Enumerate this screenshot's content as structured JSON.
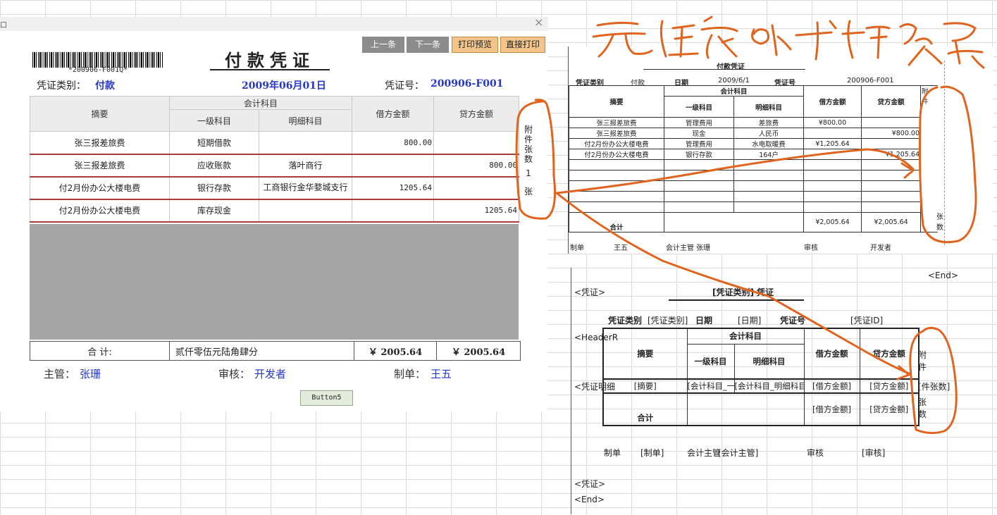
{
  "dialog": {
    "title": "口",
    "close_icon": "close-icon",
    "barcode_text": "*200906-F001Q*",
    "voucher_title": "付款凭证",
    "buttons": {
      "prev": "上一条",
      "next": "下一条",
      "preview": "打印预览",
      "print": "直接打印"
    },
    "type_label": "凭证类别：",
    "type_value": "付款",
    "date_value": "2009年06月01日",
    "number_label": "凭证号：",
    "number_value": "200906-F001",
    "table": {
      "headers": {
        "summary": "摘要",
        "account_group": "会计科目",
        "level1": "一级科目",
        "detail": "明细科目",
        "debit": "借方金额",
        "credit": "贷方金额"
      },
      "rows": [
        {
          "summary": "张三报差旅费",
          "level1": "短期借款",
          "detail": "",
          "debit": "800.00",
          "credit": ""
        },
        {
          "summary": "张三报差旅费",
          "level1": "应收账款",
          "detail": "落叶商行",
          "debit": "",
          "credit": "800.00"
        },
        {
          "summary": "付2月份办公大楼电费",
          "level1": "银行存款",
          "detail": "工商银行金华婺城支行",
          "debit": "1205.64",
          "credit": ""
        },
        {
          "summary": "付2月份办公大楼电费",
          "level1": "库存现金",
          "detail": "",
          "debit": "",
          "credit": "1205.64"
        }
      ]
    },
    "attachment": {
      "label": "附件张数",
      "count": "1",
      "unit": "张"
    },
    "total": {
      "label": "合  计:",
      "amount_words": "贰仟零伍元陆角肆分",
      "debit": "￥ 2005.64",
      "credit": "￥ 2005.64"
    },
    "signatures": {
      "supervisor_label": "主管：",
      "supervisor": "张珊",
      "auditor_label": "审核：",
      "auditor": "开发者",
      "maker_label": "制单：",
      "maker": "王五"
    },
    "button5": "Button5"
  },
  "preview": {
    "title": "付款凭证",
    "type_label": "凭证类别",
    "type_value": "付款",
    "date_label": "日期",
    "date_value": "2009/6/1",
    "number_label": "凭证号",
    "number_value": "200906-F001",
    "headers": {
      "summary": "摘要",
      "account_group": "会计科目",
      "level1": "一级科目",
      "detail": "明细科目",
      "debit": "借方金额",
      "credit": "贷方金额",
      "attach": "附件"
    },
    "rows": [
      {
        "summary": "张三报差旅费",
        "level1": "管理费用",
        "detail": "差旅费",
        "debit": "¥800.00",
        "credit": ""
      },
      {
        "summary": "张三报差旅费",
        "level1": "现金",
        "detail": "人民币",
        "debit": "",
        "credit": "¥800.00"
      },
      {
        "summary": "付2月份办公大楼电费",
        "level1": "管理费用",
        "detail": "水电取暖费",
        "debit": "¥1,205.64",
        "credit": ""
      },
      {
        "summary": "付2月份办公大楼电费",
        "level1": "银行存款",
        "detail": "164户",
        "debit": "",
        "credit": "¥1,205.64"
      }
    ],
    "total_label": "合计",
    "total_debit": "¥2,005.64",
    "total_credit": "¥2,005.64",
    "total_unit": "张数",
    "footer": {
      "maker_label": "制单",
      "maker": "王五",
      "supervisor": "会计主管 张珊",
      "auditor_label": "审核",
      "developer": "开发者"
    }
  },
  "template": {
    "end_top": "<End>",
    "voucher_tag": "<凭证>",
    "title": "[凭证类别]  凭证",
    "type_label": "凭证类别",
    "type_value": "[凭证类别]",
    "date_label": "日期",
    "date_value": "[日期]",
    "number_label": "凭证号",
    "number_value": "[凭证ID]",
    "header_tag": "<HeaderR",
    "detail_tag": "<凭证明细",
    "headers": {
      "summary": "摘要",
      "account_group": "会计科目",
      "level1": "一级科目",
      "detail": "明细科目",
      "debit": "借方金额",
      "credit": "贷方金额",
      "attach": "附件"
    },
    "row": {
      "summary": "[摘要]",
      "level1": "[会计科目_一级科目]",
      "detail": "[会计科目_明细科目]",
      "debit": "[借方金额]",
      "credit": "[贷方金额]",
      "attach": "[件张数]"
    },
    "total": {
      "label": "合计",
      "debit": "[借方金额]",
      "credit": "[贷方金额]",
      "unit": "张数"
    },
    "footer": {
      "maker_label": "制单",
      "maker": "[制单]",
      "supervisor_label": "会计主管",
      "supervisor": "[会计主管]",
      "auditor_label": "审核",
      "auditor": "[审核]"
    },
    "voucher_tag_bottom": "<凭证>",
    "end_bottom": "<End>"
  },
  "annotation": {
    "text": "无法实现一样效果"
  },
  "colors": {
    "accent_blue": "#2636c8",
    "ink_orange": "#e0641e",
    "row_border": "#a83a3a",
    "gray_area": "#a5a5a5"
  }
}
